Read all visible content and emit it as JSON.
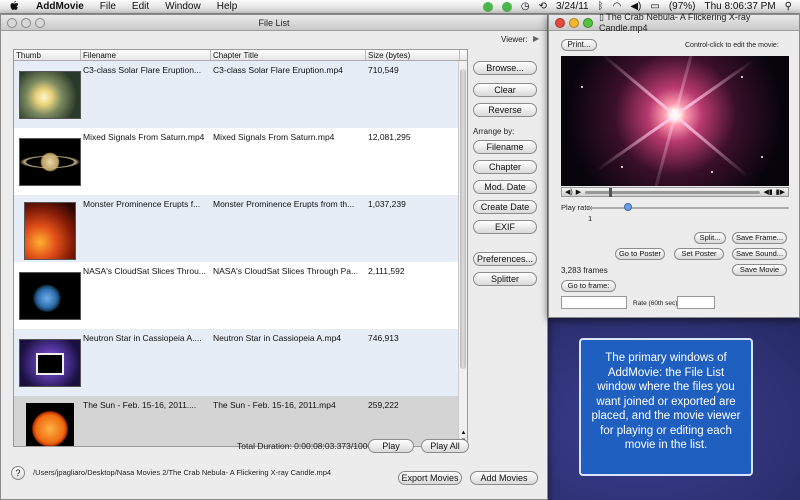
{
  "menubar": {
    "apple": "",
    "app": "AddMovie",
    "items": [
      "File",
      "Edit",
      "Window",
      "Help"
    ],
    "date": "3/24/11",
    "battery": "(97%)",
    "clock": "Thu 8:06:37 PM"
  },
  "filelist": {
    "title": "File List",
    "viewer_label": "Viewer:",
    "columns": {
      "thumb": "Thumb",
      "filename": "Filename",
      "chapter": "Chapter Title",
      "size": "Size (bytes)"
    },
    "rows": [
      {
        "filename": "C3-class Solar Flare Eruption...",
        "chapter": "C3-class Solar Flare Eruption.mp4",
        "size": "710,549"
      },
      {
        "filename": "Mixed Signals From Saturn.mp4",
        "chapter": "Mixed Signals From Saturn.mp4",
        "size": "12,081,295"
      },
      {
        "filename": "Monster Prominence Erupts f...",
        "chapter": "Monster Prominence Erupts from th...",
        "size": "1,037,239"
      },
      {
        "filename": "NASA's CloudSat Slices Throu...",
        "chapter": "NASA's CloudSat Slices Through Pa...",
        "size": "2,111,592"
      },
      {
        "filename": "Neutron Star in Cassiopeia A....",
        "chapter": "Neutron Star in Cassiopeia A.mp4",
        "size": "746,913"
      },
      {
        "filename": "The Sun - Feb. 15-16, 2011....",
        "chapter": "The Sun - Feb. 15-16, 2011.mp4",
        "size": "259,222"
      }
    ],
    "buttons": {
      "browse": "Browse...",
      "clear": "Clear",
      "reverse": "Reverse",
      "arrange_by": "Arrange by:",
      "filename": "Filename",
      "chapter": "Chapter",
      "mod_date": "Mod. Date",
      "create_date": "Create Date",
      "exif": "EXIF",
      "preferences": "Preferences...",
      "splitter": "Splitter",
      "play": "Play",
      "play_all": "Play All",
      "export": "Export Movies",
      "add": "Add Movies"
    },
    "total_duration": "Total Duration: 0:00:08:03.373/1000",
    "path": "/Users/jpagliaro/Desktop/Nasa Movies 2/The Crab Nebula- A Flickering X-ray Candle.mp4",
    "help": "?"
  },
  "viewer": {
    "title": "The Crab Nebula- A Flickering X-ray Candle.mp4",
    "print": "Print...",
    "hint": "Control-click to edit the movie:",
    "play_rate_label": "Play rate:",
    "play_rate_value": "1",
    "play_rate_fraction": 0.2,
    "frames": "3,283 frames",
    "buttons": {
      "split": "Split...",
      "save_frame": "Save Frame...",
      "go_to_poster": "Go to Poster",
      "set_poster": "Set Poster",
      "save_sound": "Save Sound...",
      "save_movie": "Save Movie",
      "go_to_frame": "Go to frame:"
    },
    "rate_label": "Rate (60th sec):"
  },
  "info_text": "The primary windows of AddMovie: the File List window where the files you want joined or exported are placed, and the movie viewer for playing or editing each movie in the list.",
  "colors": {
    "info_bg": "#1f5fbf",
    "row_alt": "#e6edf7",
    "row_selected": "#d4d4d4"
  }
}
